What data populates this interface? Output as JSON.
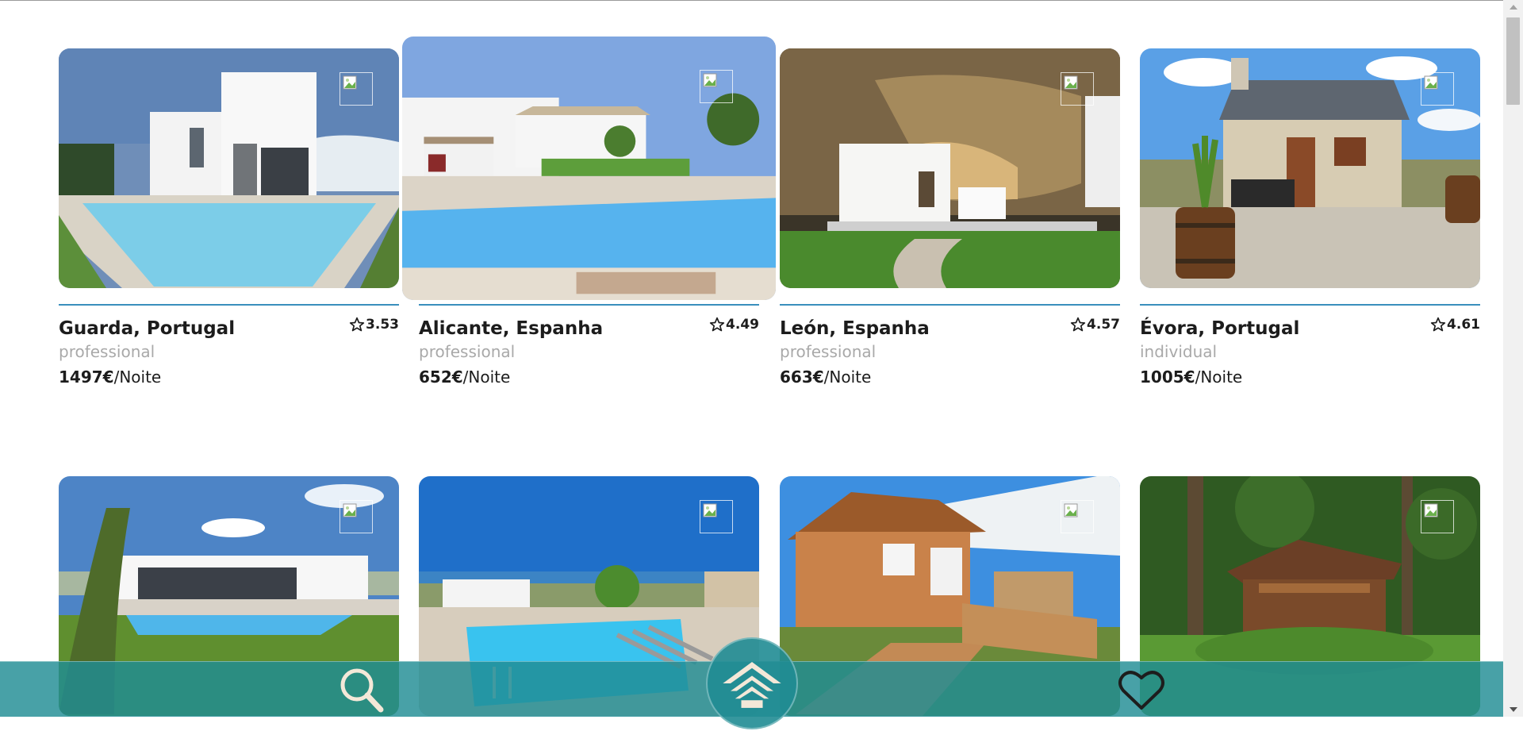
{
  "listings": [
    {
      "title": "Guarda, Portugal",
      "rating": "3.53",
      "host_type": "professional",
      "price": "1497€",
      "price_unit": "/Noite",
      "photo": "modern white villa with pool"
    },
    {
      "title": "Alicante, Espanha",
      "rating": "4.49",
      "host_type": "professional",
      "price": "652€",
      "price_unit": "/Noite",
      "photo": "white house with pool and lawn"
    },
    {
      "title": "León, Espanha",
      "rating": "4.57",
      "host_type": "professional",
      "price": "663€",
      "price_unit": "/Noite",
      "photo": "cave house under rock cliff"
    },
    {
      "title": "Évora, Portugal",
      "rating": "4.61",
      "host_type": "individual",
      "price": "1005€",
      "price_unit": "/Noite",
      "photo": "small stone cottage with barrels"
    },
    {
      "title": "",
      "rating": "",
      "host_type": "",
      "price": "",
      "price_unit": "",
      "photo": "modern house with pool and lawn"
    },
    {
      "title": "",
      "rating": "",
      "host_type": "",
      "price": "",
      "price_unit": "",
      "photo": "pool with sun loungers and pergola"
    },
    {
      "title": "",
      "rating": "",
      "host_type": "",
      "price": "",
      "price_unit": "",
      "photo": "wooden cabin with deck and shade sail"
    },
    {
      "title": "",
      "rating": "",
      "host_type": "",
      "price": "",
      "price_unit": "",
      "photo": "wooden bungalow in garden"
    }
  ],
  "icons": {
    "favorite": "broken-image-icon",
    "rating": "star-outline-icon",
    "search": "search-icon",
    "home": "home-icon",
    "favorites": "heart-outline-icon"
  },
  "colors": {
    "accent_line": "#3a8fbd",
    "navbar": "#208c94",
    "host_text": "#a9a9a9"
  }
}
